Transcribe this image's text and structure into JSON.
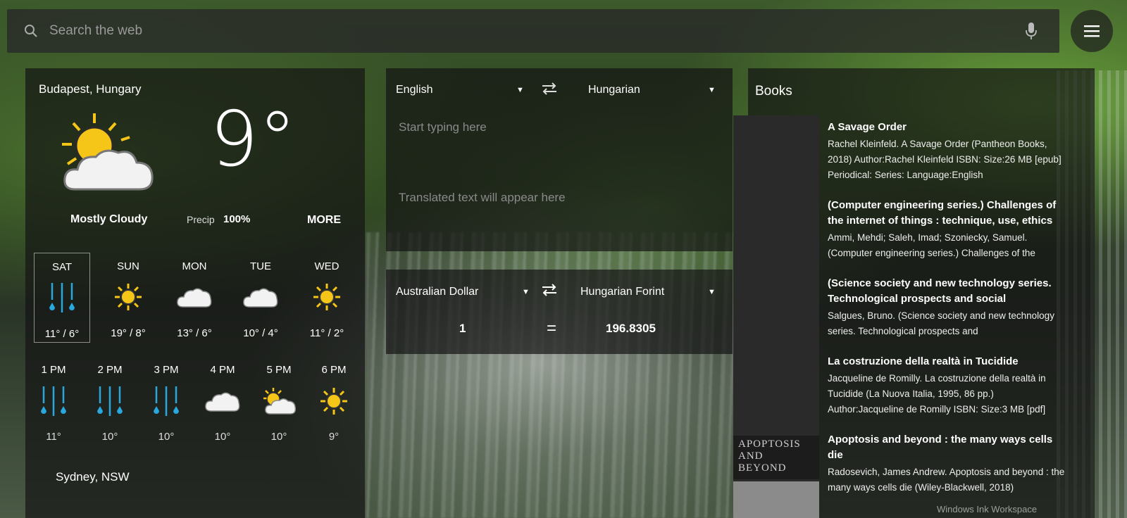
{
  "search": {
    "placeholder": "Search the web"
  },
  "weather": {
    "city": "Budapest, Hungary",
    "temperature": "9°",
    "condition": "Mostly Cloudy",
    "precip_label": "Precip",
    "precip_value": "100%",
    "more_label": "MORE",
    "days": [
      {
        "name": "SAT",
        "range": "11° / 6°",
        "icon": "rain-icon",
        "selected": true
      },
      {
        "name": "SUN",
        "range": "19° / 8°",
        "icon": "sun-icon"
      },
      {
        "name": "MON",
        "range": "13° / 6°",
        "icon": "cloud-icon"
      },
      {
        "name": "TUE",
        "range": "10° / 4°",
        "icon": "cloud-icon"
      },
      {
        "name": "WED",
        "range": "11° / 2°",
        "icon": "sun-icon"
      }
    ],
    "hours": [
      {
        "name": "1 PM",
        "temp": "11°",
        "icon": "rain-icon"
      },
      {
        "name": "2 PM",
        "temp": "10°",
        "icon": "rain-icon"
      },
      {
        "name": "3 PM",
        "temp": "10°",
        "icon": "rain-icon"
      },
      {
        "name": "4 PM",
        "temp": "10°",
        "icon": "cloud-icon"
      },
      {
        "name": "5 PM",
        "temp": "10°",
        "icon": "partly-sunny-icon"
      },
      {
        "name": "6 PM",
        "temp": "9°",
        "icon": "sun-icon"
      }
    ],
    "city2": "Sydney, NSW"
  },
  "translator": {
    "from_lang": "English",
    "to_lang": "Hungarian",
    "input_placeholder": "Start typing here",
    "output_placeholder": "Translated text will appear here"
  },
  "currency": {
    "from": "Australian Dollar",
    "to": "Hungarian Forint",
    "amount": "1",
    "equals": "=",
    "result": "196.8305"
  },
  "books": {
    "title": "Books",
    "cover_title_1": "APOPTOSIS",
    "cover_title_2": "AND BEYOND",
    "items": [
      {
        "title": "A Savage Order",
        "desc": "Rachel Kleinfeld. A Savage Order (Pantheon Books, 2018) Author:Rachel Kleinfeld ISBN: Size:26 MB [epub] Periodical: Series: Language:English"
      },
      {
        "title": "(Computer engineering series.) Challenges of the internet of things : technique, use, ethics",
        "desc": "Ammi, Mehdi; Saleh, Imad; Szoniecky, Samuel. (Computer engineering series.) Challenges of the"
      },
      {
        "title": "(Science society and new technology series. Technological prospects and social",
        "desc": "Salgues, Bruno. (Science society and new technology series. Technological prospects and"
      },
      {
        "title": "La costruzione della realtà in Tucidide",
        "desc": "Jacqueline de Romilly. La costruzione della realtà in Tucidide (La Nuova Italia, 1995, 86 pp.) Author:Jacqueline de Romilly ISBN: Size:3 MB [pdf]"
      },
      {
        "title": "Apoptosis and beyond : the many ways cells die",
        "desc": "Radosevich, James Andrew. Apoptosis and beyond : the many ways cells die (Wiley-Blackwell, 2018)"
      }
    ]
  },
  "watermark": "Windows Ink Workspace"
}
